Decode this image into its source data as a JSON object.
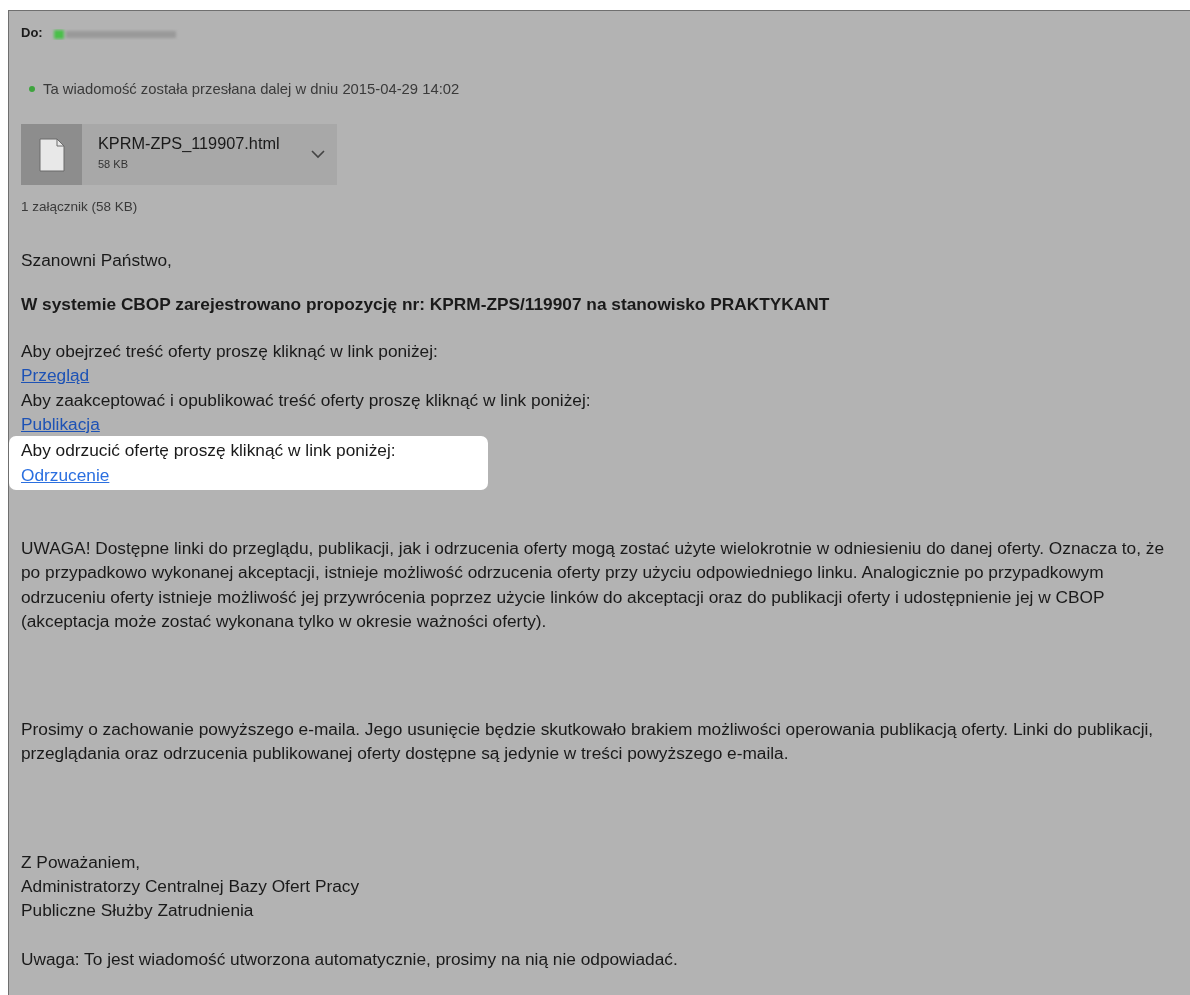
{
  "header": {
    "to_label": "Do:"
  },
  "forward_note": "Ta wiadomość została przesłana dalej w dniu 2015-04-29 14:02",
  "attachment": {
    "name": "KPRM-ZPS_119907.html",
    "size": "58 KB",
    "summary": "1 załącznik (58 KB)"
  },
  "body": {
    "greeting": "Szanowni Państwo,",
    "headline": "W systemie CBOP zarejestrowano propozycję nr: KPRM-ZPS/119907 na stanowisko PRAKTYKANT",
    "link_blocks": [
      {
        "instruction": "Aby obejrzeć treść oferty proszę kliknąć w link poniżej:",
        "link": "Przegląd",
        "highlighted": false
      },
      {
        "instruction": "Aby zaakceptować i opublikować treść oferty proszę kliknąć w link poniżej:",
        "link": "Publikacja",
        "highlighted": false
      },
      {
        "instruction": "Aby odrzucić ofertę proszę kliknąć w link poniżej:",
        "link": "Odrzucenie",
        "highlighted": true
      }
    ],
    "notice": "UWAGA! Dostępne linki do przeglądu, publikacji, jak i odrzucenia oferty mogą zostać użyte wielokrotnie w odniesieniu do danej oferty. Oznacza to, że po przypadkowo wykonanej akceptacji, istnieje możliwość odrzucenia oferty przy użyciu odpowiedniego linku. Analogicznie po przypadkowym odrzuceniu oferty istnieje możliwość jej przywrócenia poprzez użycie linków do akceptacji oraz do publikacji oferty i udostępnienie jej w CBOP (akceptacja może zostać wykonana tylko w okresie ważności oferty).",
    "request": "Prosimy o zachowanie powyższego e-maila. Jego usunięcie będzie skutkowało brakiem możliwości operowania publikacją oferty. Linki do publikacji, przeglądania oraz odrzucenia publikowanej oferty dostępne są jedynie w treści powyższego e-maila.",
    "signature": [
      "Z Poważaniem,",
      "Administratorzy Centralnej Bazy Ofert Pracy",
      "Publiczne Służby Zatrudnienia"
    ],
    "auto_note": "Uwaga: To jest wiadomość utworzona automatycznie, prosimy na nią nie odpowiadać."
  }
}
